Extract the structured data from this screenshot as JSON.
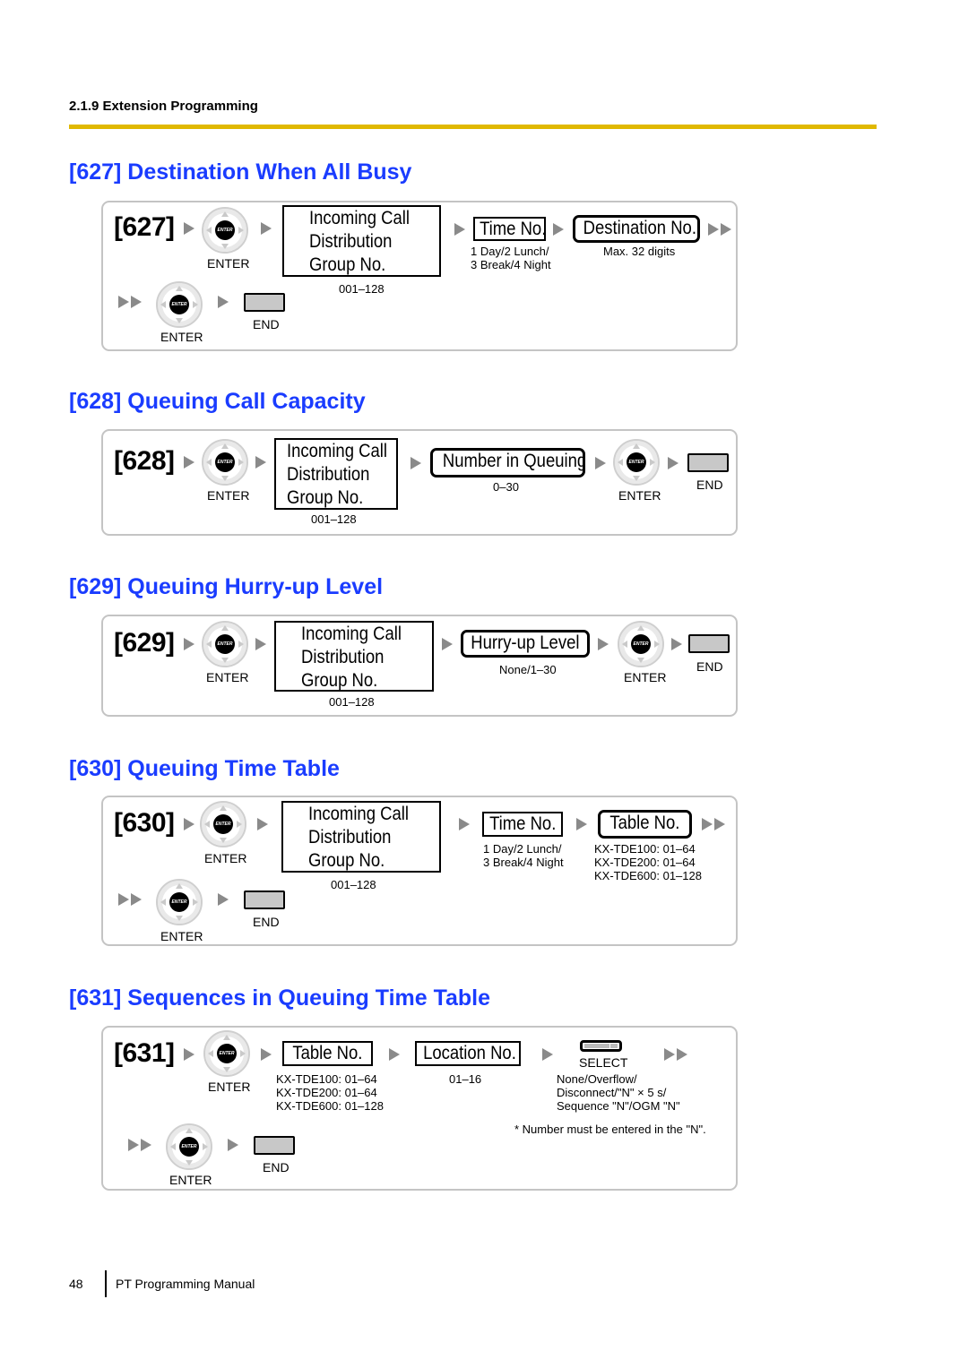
{
  "header": {
    "section": "2.1.9 Extension Programming",
    "rule_color": "#e0b800",
    "title_color": "#1a3cff"
  },
  "sections": [
    {
      "title": "[627] Destination When All Busy",
      "code": "[627]",
      "enter_label": "ENTER",
      "enter_key_text": "ENTER",
      "icd_lines": [
        "Incoming Call",
        "Distribution",
        "Group No."
      ],
      "icd_range": "001–128",
      "time_no": "Time No.",
      "time_options": "1 Day/2 Lunch/\n3 Break/4 Night",
      "destination_no": "Destination No.",
      "destination_range": "Max. 32 digits",
      "end_label": "END"
    },
    {
      "title": "[628] Queuing Call Capacity",
      "code": "[628]",
      "enter_label": "ENTER",
      "enter_key_text": "ENTER",
      "icd_lines": [
        "Incoming Call",
        "Distribution",
        "Group No."
      ],
      "icd_range": "001–128",
      "field": "Number in Queuing",
      "field_range": "0–30",
      "end_label": "END"
    },
    {
      "title": "[629] Queuing Hurry-up Level",
      "code": "[629]",
      "enter_label": "ENTER",
      "enter_key_text": "ENTER",
      "icd_lines": [
        "Incoming Call",
        "Distribution",
        "Group No."
      ],
      "icd_range": "001–128",
      "field": "Hurry-up Level",
      "field_range": "None/1–30",
      "end_label": "END"
    },
    {
      "title": "[630] Queuing Time Table",
      "code": "[630]",
      "enter_label": "ENTER",
      "enter_key_text": "ENTER",
      "icd_lines": [
        "Incoming Call",
        "Distribution",
        "Group No."
      ],
      "icd_range": "001–128",
      "time_no": "Time No.",
      "time_options": "1 Day/2 Lunch/\n3 Break/4 Night",
      "table_no": "Table No.",
      "table_ranges": "KX-TDE100: 01–64\nKX-TDE200: 01–64\nKX-TDE600: 01–128",
      "end_label": "END"
    },
    {
      "title": "[631] Sequences in Queuing Time Table",
      "code": "[631]",
      "enter_label": "ENTER",
      "enter_key_text": "ENTER",
      "table_no": "Table No.",
      "table_ranges": "KX-TDE100: 01–64\nKX-TDE200: 01–64\nKX-TDE600: 01–128",
      "location_no": "Location No.",
      "location_range": "01–16",
      "select_label": "SELECT",
      "select_options": "None/Overflow/\nDisconnect/\"N\" × 5 s/\nSequence \"N\"/OGM \"N\"",
      "note": "* Number must be entered in the \"N\".",
      "end_label": "END"
    }
  ],
  "footer": {
    "page_number": "48",
    "manual_title": "PT Programming Manual"
  }
}
